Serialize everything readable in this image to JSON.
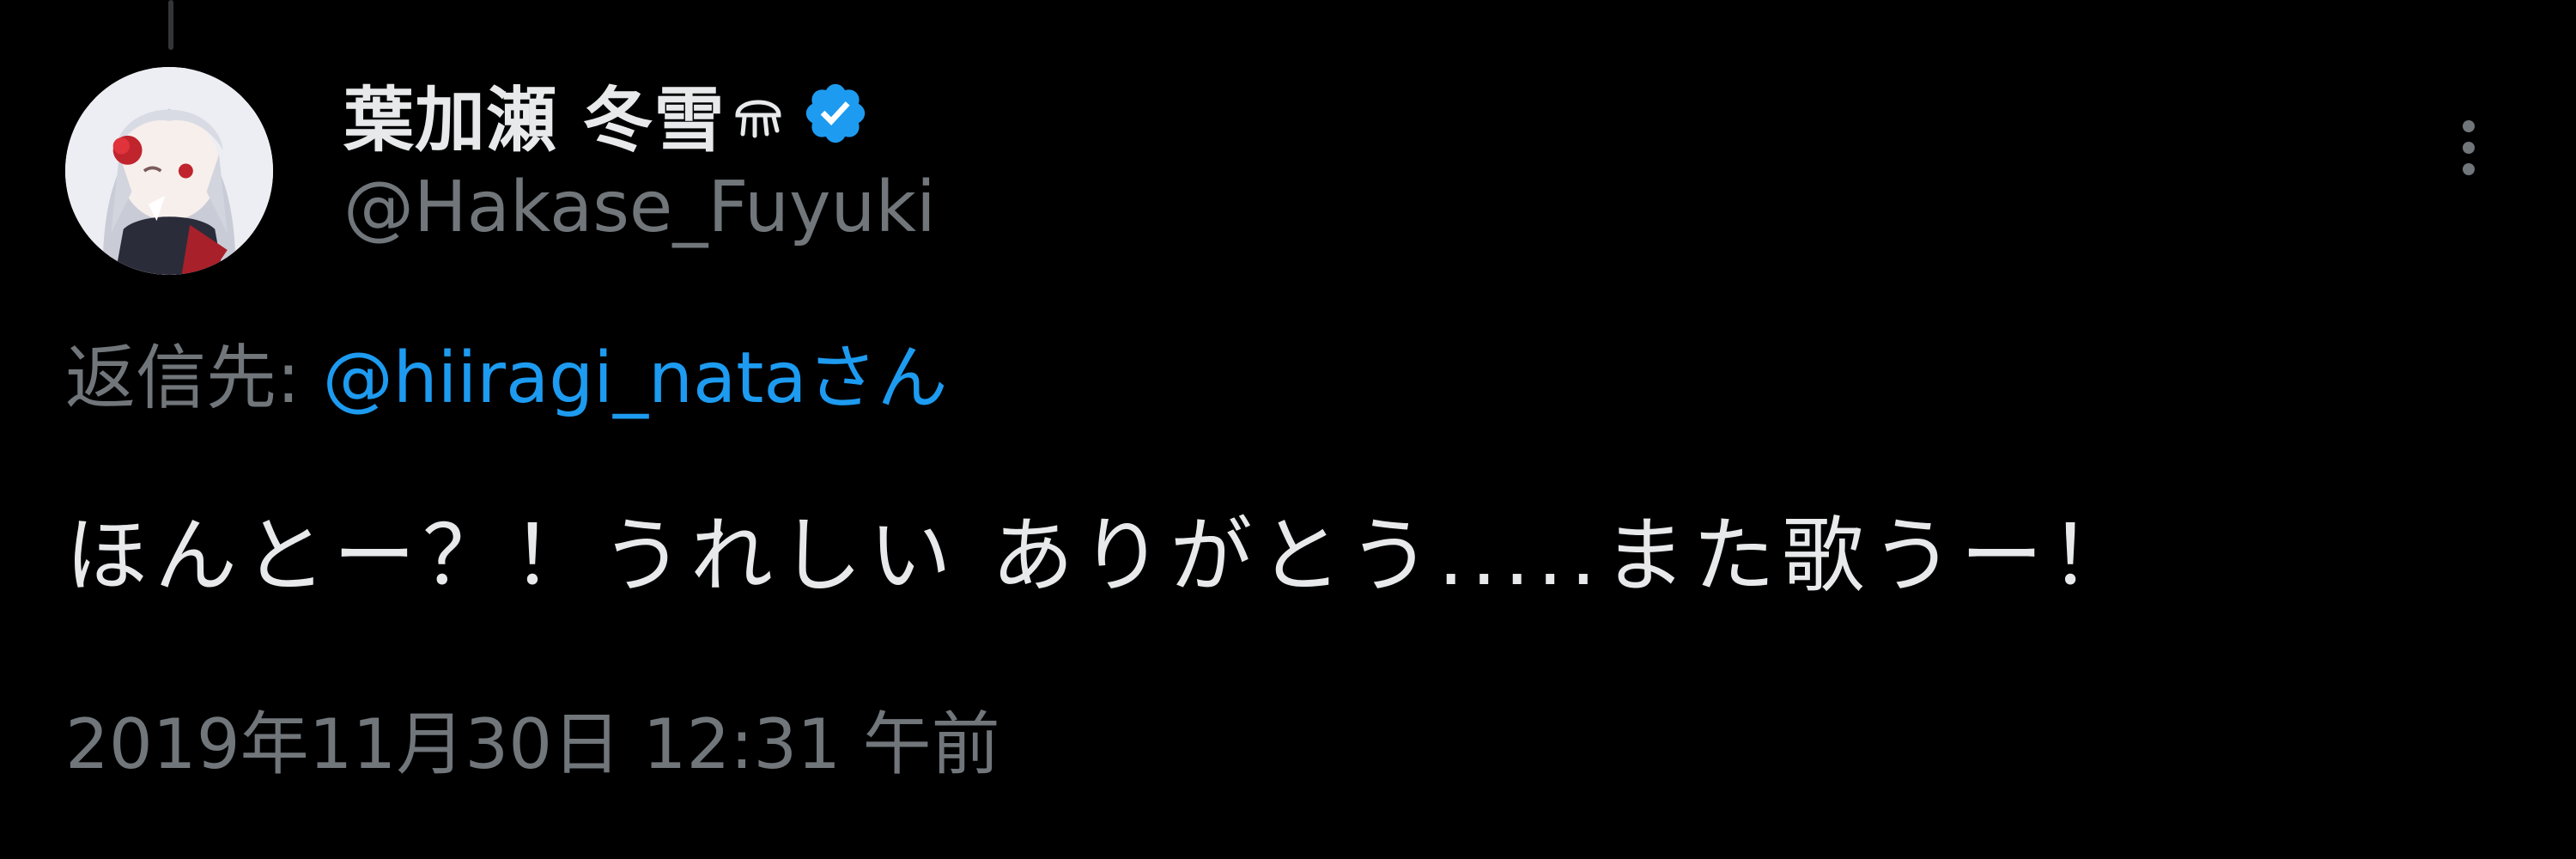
{
  "author": {
    "display_name": "葉加瀬 冬雪",
    "emoji_icon": "jellyfish-emoji-icon",
    "verified_icon": "verified-badge-icon",
    "handle": "@Hakase_Fuyuki"
  },
  "more_icon": "more-vertical-icon",
  "reply": {
    "prefix": "返信先: ",
    "mention": "@hiiragi_nata",
    "suffix": "さん"
  },
  "tweet": {
    "text": "ほんとー？！うれしい ありがとう.....また歌うー！",
    "timestamp": "2019年11月30日 12:31 午前"
  },
  "colors": {
    "background": "#000000",
    "primary_text": "#e7e9ea",
    "secondary_text": "#71767b",
    "accent": "#1d9bf0"
  }
}
